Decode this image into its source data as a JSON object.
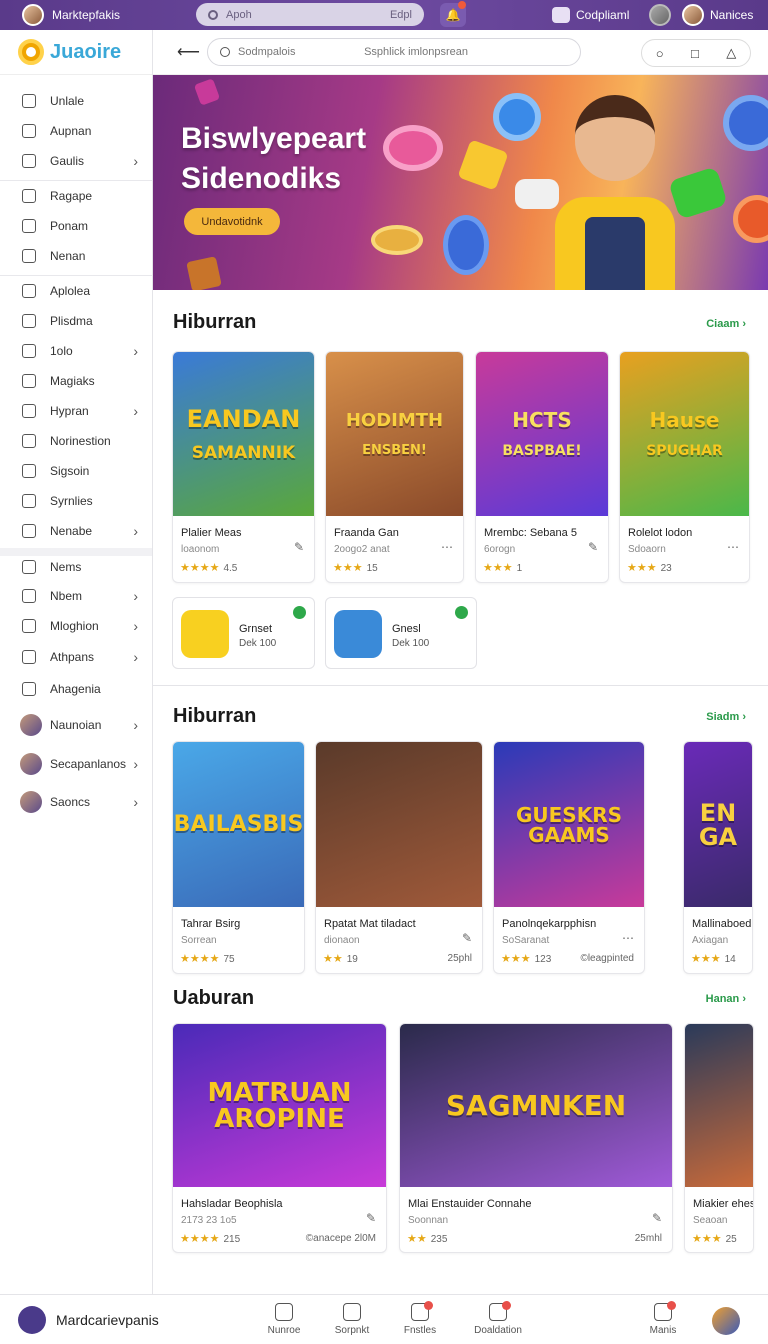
{
  "topbar": {
    "title": "Marktepfakis",
    "search_placeholder": "Apoh",
    "search_right": "Edpl",
    "user1": "Codpliaml",
    "user2": "Nanices"
  },
  "brand": {
    "name": "Juaoire"
  },
  "sidebar": {
    "items": [
      {
        "label": "Unlale",
        "chevron": false
      },
      {
        "label": "Aupnan",
        "chevron": false
      },
      {
        "label": "Gaulis",
        "chevron": true
      },
      {
        "label": "Ragape",
        "chevron": false
      },
      {
        "label": "Ponam",
        "chevron": false
      },
      {
        "label": "Nenan",
        "chevron": false
      },
      {
        "label": "Aplolea",
        "chevron": false
      },
      {
        "label": "Plisdma",
        "chevron": false
      },
      {
        "label": "1olo",
        "chevron": true
      },
      {
        "label": "Magiaks",
        "chevron": false
      },
      {
        "label": "Hypran",
        "chevron": true
      },
      {
        "label": "Norinestion",
        "chevron": false
      },
      {
        "label": "Sigsoin",
        "chevron": false
      },
      {
        "label": "Syrnlies",
        "chevron": false
      },
      {
        "label": "Nenabe",
        "chevron": true
      }
    ],
    "items2": [
      {
        "label": "Nems",
        "chevron": false
      },
      {
        "label": "Nbem",
        "chevron": true
      },
      {
        "label": "Mloghion",
        "chevron": true
      },
      {
        "label": "Athpans",
        "chevron": true
      },
      {
        "label": "Ahagenia",
        "chevron": false
      }
    ],
    "people": [
      {
        "label": "Naunoian"
      },
      {
        "label": "Secapanlanos"
      },
      {
        "label": "Saoncs"
      }
    ]
  },
  "toolbar": {
    "search_placeholder": "Sodmpalois",
    "search_hint": "Ssphlick imlonpsrean"
  },
  "hero": {
    "line1": "Biswlyepeart",
    "line2": "Sidenodiks",
    "cta": "Undavotidnk"
  },
  "section1": {
    "title": "Hiburran",
    "link": "Ciaam",
    "cards": [
      {
        "art": "EANDAN",
        "art2": "SAMANNIK",
        "name": "Plalier Meas",
        "sub": "loaonom",
        "stars": "★★★★",
        "rating": "4.5",
        "action": "✎",
        "bg1": "#3a7ad8",
        "bg2": "#5aa83a",
        "color": "#f8c820"
      },
      {
        "art": "HODIMTH",
        "art2": "ENSBEN!",
        "name": "Fraanda Gan",
        "sub": "2oogo2 anat",
        "stars": "★★★",
        "rating": "15",
        "action": "⋯",
        "bg1": "#d8904a",
        "bg2": "#8a4a2a",
        "color": "#f8d040"
      },
      {
        "art": "HCTS",
        "art2": "BASPBAE!",
        "name": "Mrembc: Sebana 5",
        "sub": "6orogn",
        "stars": "★★★",
        "rating": "1",
        "action": "✎",
        "bg1": "#c83a9a",
        "bg2": "#5a3ad8",
        "color": "#f8e060"
      },
      {
        "art": "Hause",
        "art2": "SPUGHAR",
        "name": "Rolelot lodon",
        "sub": "Sdoaorn",
        "stars": "★★★",
        "rating": "23",
        "action": "⋯",
        "bg1": "#e8a020",
        "bg2": "#4ab84a",
        "color": "#f8c820"
      }
    ],
    "mini": [
      {
        "title": "Grnset",
        "meta": "Dek 100",
        "bg": "#f8d020"
      },
      {
        "title": "Gnesl",
        "meta": "Dek 100",
        "bg": "#3a8ad8"
      }
    ]
  },
  "section2": {
    "title": "Hiburran",
    "link": "Siadm",
    "cards": [
      {
        "art": "BAILASBIS",
        "name": "Tahrar Bsirg",
        "sub": "Sorrean",
        "stars": "★★★★",
        "rating": "75",
        "action": "",
        "side": "",
        "bg1": "#4aa8e8",
        "bg2": "#3a6ab8",
        "color": "#f8c820"
      },
      {
        "art": "",
        "name": "Rpatat Mat tiladact",
        "sub": "dionaon",
        "stars": "★★",
        "rating": "19",
        "action": "✎",
        "side": "25phl",
        "bg1": "#5a3a2a",
        "bg2": "#a05a3a",
        "color": "#fff"
      },
      {
        "art": "GUESKRS GAAMS",
        "name": "Panolnqekarpphisn",
        "sub": "SoSaranat",
        "stars": "★★★",
        "rating": "123",
        "action": "⋯",
        "side": "©leagpinted",
        "bg1": "#2a3ab8",
        "bg2": "#c83a9a",
        "color": "#f8c820"
      },
      {
        "art": "EN GA",
        "name": "Mallinaboed",
        "sub": "Axiagan",
        "stars": "★★★",
        "rating": "14",
        "action": "",
        "side": "",
        "bg1": "#6a2ab8",
        "bg2": "#3a2a6a",
        "color": "#f8d040"
      }
    ]
  },
  "section3": {
    "title": "Uaburan",
    "link": "Hanan",
    "cards": [
      {
        "art": "MATRUAN AROPINE",
        "name": "Hahsladar Beophisla",
        "sub": "2173 23 1o5",
        "stars": "★★★★",
        "rating": "215",
        "action": "✎",
        "side": "©anacepe 2l0M",
        "bg1": "#4a2ab8",
        "bg2": "#c83ad8",
        "color": "#f8c820"
      },
      {
        "art": "SAGMNKEN",
        "name": "Mlai Enstauider Connahe",
        "sub": "Soonnan",
        "stars": "★★",
        "rating": "235",
        "action": "✎",
        "side": "25mhl",
        "bg1": "#2a2a4a",
        "bg2": "#a05ad8",
        "color": "#f8c820"
      },
      {
        "art": "",
        "name": "Miakier ehest",
        "sub": "Seaoan",
        "stars": "★★★",
        "rating": "25",
        "action": "",
        "side": "",
        "bg1": "#2a3a5a",
        "bg2": "#c86a3a",
        "color": "#fff"
      }
    ]
  },
  "bottom": {
    "name": "Mardcarievpanis",
    "items": [
      {
        "label": "Nunroe",
        "badge": false
      },
      {
        "label": "Sorpnkt",
        "badge": false
      },
      {
        "label": "Fnstles",
        "badge": true
      },
      {
        "label": "Doaldation",
        "badge": true
      },
      {
        "label": "Manis",
        "badge": true
      }
    ]
  }
}
